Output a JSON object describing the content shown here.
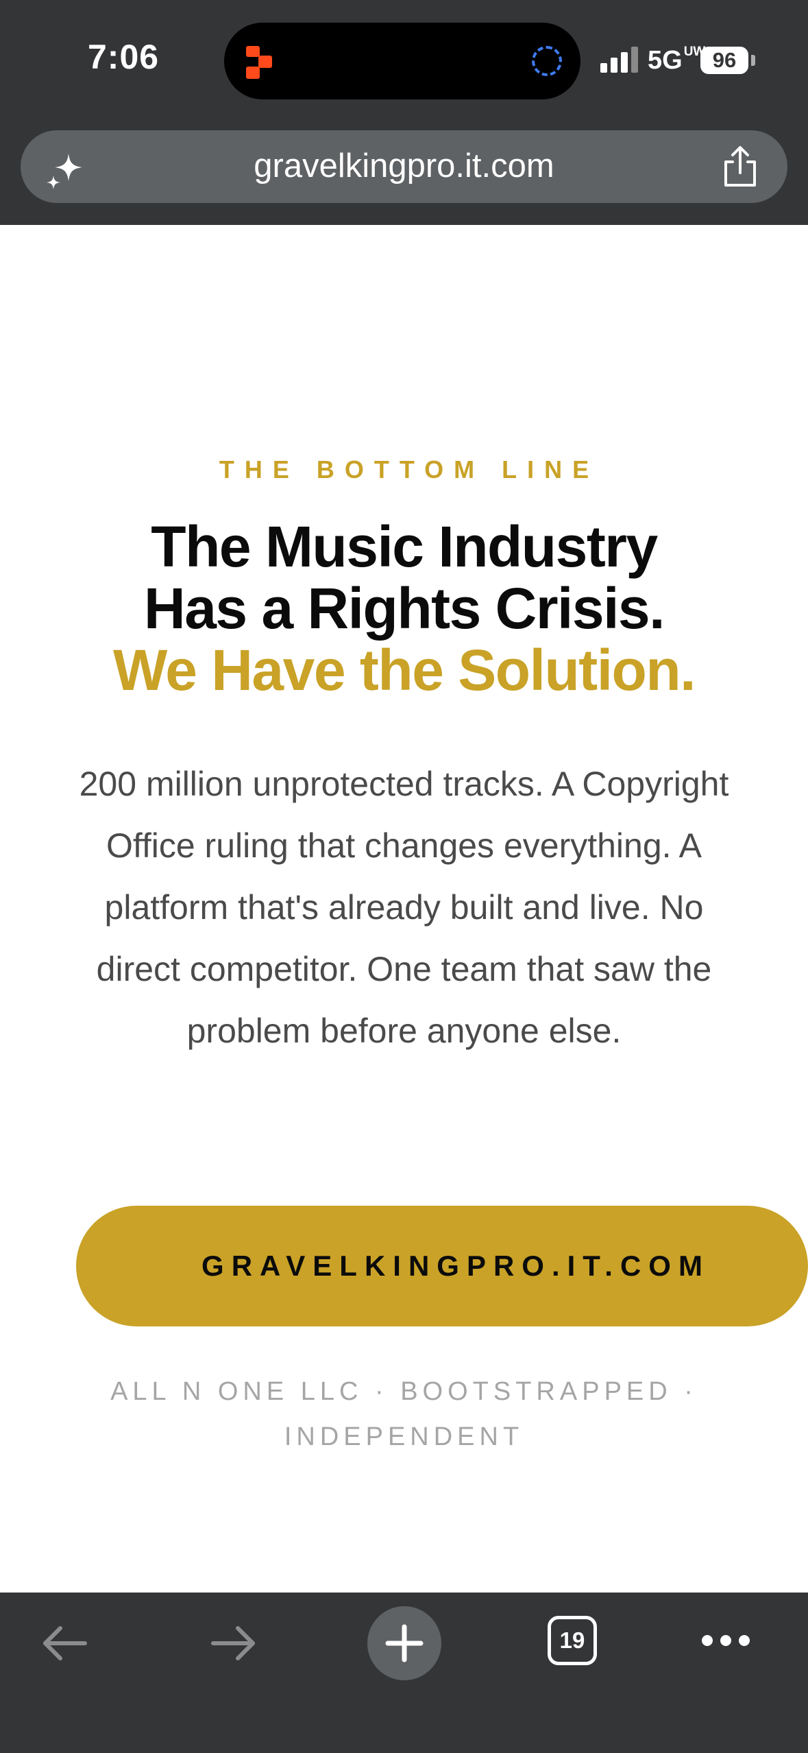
{
  "status_bar": {
    "time": "7:06",
    "network": "5G",
    "network_superscript": "UW",
    "battery": "96"
  },
  "browser": {
    "url": "gravelkingpro.it.com",
    "tabs_count": "19",
    "icons": [
      "sparkle-icon",
      "share-icon",
      "back-arrow-icon",
      "forward-arrow-icon",
      "plus-icon",
      "tabs-icon",
      "more-icon"
    ]
  },
  "page": {
    "eyebrow": "THE BOTTOM LINE",
    "headline_line1": "The Music Industry",
    "headline_line2": "Has a Rights Crisis.",
    "headline_accent": "We Have the Solution.",
    "body": "200 million unprotected tracks. A Copyright Office ruling that changes everything. A platform that's already built and live. No direct competitor. One team that saw the problem before anyone else.",
    "cta_label": "GRAVELKINGPRO.IT.COM",
    "footnote_line1": "ALL N ONE LLC · BOOTSTRAPPED ·",
    "footnote_line2": "INDEPENDENT"
  },
  "colors": {
    "accent": "#c9a227",
    "chrome": "#343537",
    "url_bar": "#5f6264",
    "headline": "#0b0b0b",
    "body_text": "#4a4a4a",
    "footnote": "#a5a5a5"
  }
}
